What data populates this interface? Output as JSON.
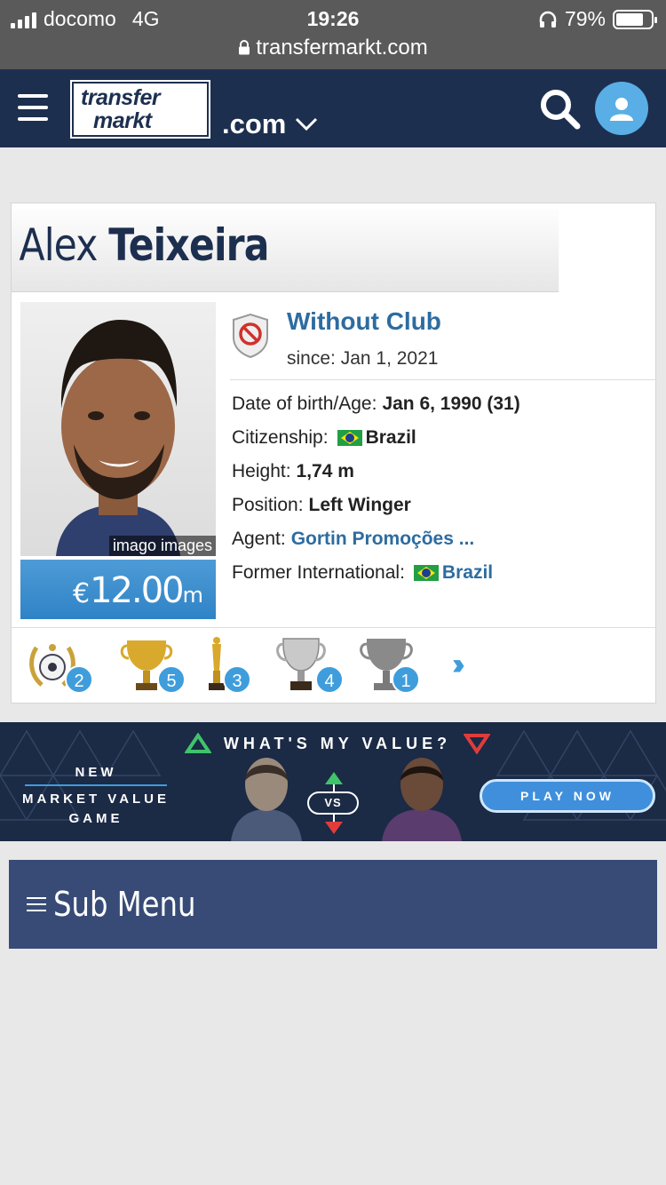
{
  "status_bar": {
    "carrier": "docomo",
    "network": "4G",
    "time": "19:26",
    "battery": "79%",
    "battery_level": 0.79,
    "url": "transfermarkt.com"
  },
  "header": {
    "logo_line1": "transfer",
    "logo_line2": "markt",
    "domain": ".com",
    "icons": [
      "menu-icon",
      "search-icon",
      "user-icon",
      "chevron-down-icon"
    ],
    "colors": {
      "header_bg": "#1d2f4f",
      "accent": "#5aaee6"
    }
  },
  "player": {
    "first_name": "Alex",
    "last_name": "Teixeira",
    "photo_credit": "imago images",
    "market_value": {
      "currency": "€",
      "amount": "12.00",
      "unit": "m"
    },
    "club": {
      "name": "Without Club",
      "since": "since: Jan 1, 2021"
    },
    "details": [
      {
        "label": "Date of birth/Age:",
        "value": "Jan 6, 1990 (31)"
      },
      {
        "label": "Citizenship:",
        "value": "Brazil"
      },
      {
        "label": "Height:",
        "value": "1,74 m"
      },
      {
        "label": "Position:",
        "value": "Left Winger"
      },
      {
        "label": "Agent:",
        "value": "Gortin Promoções ..."
      },
      {
        "label": "Former International:",
        "value": "Brazil"
      }
    ]
  },
  "trophies": [
    {
      "icon": "laurel-ball-icon",
      "count": "2"
    },
    {
      "icon": "gold-cup-icon",
      "count": "5"
    },
    {
      "icon": "statuette-trophy-icon",
      "count": "3"
    },
    {
      "icon": "silver-cup-icon",
      "count": "4"
    },
    {
      "icon": "grey-cup-icon",
      "count": "1"
    }
  ],
  "banner": {
    "title": "WHAT'S MY VALUE?",
    "left_line1": "NEW",
    "left_line2": "MARKET VALUE",
    "left_line3": "GAME",
    "vs": "VS",
    "cta": "PLAY NOW"
  },
  "submenu": {
    "label": "Sub Menu"
  }
}
